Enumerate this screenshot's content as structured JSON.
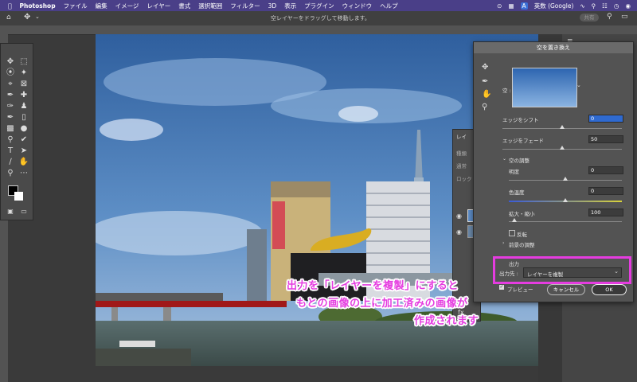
{
  "menubar": {
    "app": "Photoshop",
    "items": [
      "ファイル",
      "編集",
      "イメージ",
      "レイヤー",
      "書式",
      "選択範囲",
      "フィルター",
      "3D",
      "表示",
      "プラグイン",
      "ウィンドウ",
      "ヘルプ"
    ],
    "input_source": "英数 (Google)"
  },
  "options": {
    "hint": "空レイヤーをドラッグして移動します。",
    "share_label": "共有"
  },
  "dialog": {
    "title": "空を置き換え",
    "sky_label": "空 :",
    "shift_edge_label": "エッジをシフト",
    "shift_edge_value": "0",
    "fade_edge_label": "エッジをフェード",
    "fade_edge_value": "50",
    "sky_adjust_label": "空の調整",
    "brightness_label": "明度",
    "brightness_value": "0",
    "temperature_label": "色温度",
    "temperature_value": "0",
    "scale_label": "拡大・縮小",
    "scale_value": "100",
    "flip_label": "反転",
    "foreground_adjust_label": "前景の調整",
    "output_label": "出力",
    "output_to_label": "出力先 :",
    "output_to_value": "レイヤーを複製",
    "preview_label": "プレビュー",
    "cancel_label": "キャンセル",
    "ok_label": "OK"
  },
  "layers_panel": {
    "tab_label": "レイ",
    "lock_label": "ロック",
    "search_label": "種類",
    "blend_label": "通常"
  },
  "annotation": {
    "line1": "出力を「レイヤーを複製」にすると",
    "line2": "もとの画像の上に加工済みの画像が",
    "line3": "作成されます"
  },
  "colors": {
    "highlight": "#e53ce0",
    "menubar": "#4a3f88",
    "ok_button": "#3a3a3a"
  }
}
